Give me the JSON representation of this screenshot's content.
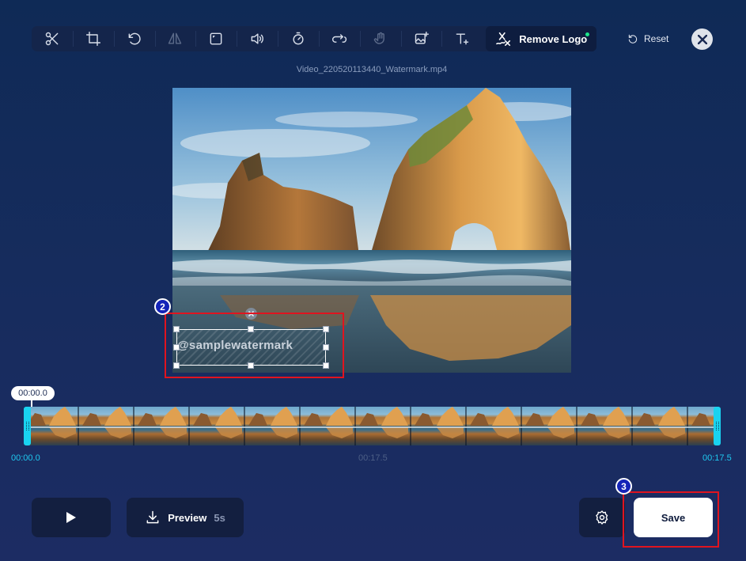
{
  "toolbar": {
    "remove_logo_label": "Remove Logo",
    "reset_label": "Reset"
  },
  "file_name": "Video_220520113440_Watermark.mp4",
  "watermark_text": "@samplewatermark",
  "steps": {
    "watermark_step": "2",
    "save_step": "3"
  },
  "timeline": {
    "playhead_time": "00:00.0",
    "start_label": "00:00.0",
    "mid_label": "00:17.5",
    "end_label": "00:17.5"
  },
  "controls": {
    "preview_label": "Preview",
    "preview_duration": "5s",
    "save_label": "Save"
  },
  "colors": {
    "accent_cyan": "#19d3f0",
    "highlight_red": "#e0141f",
    "active_dot": "#1de58a"
  }
}
